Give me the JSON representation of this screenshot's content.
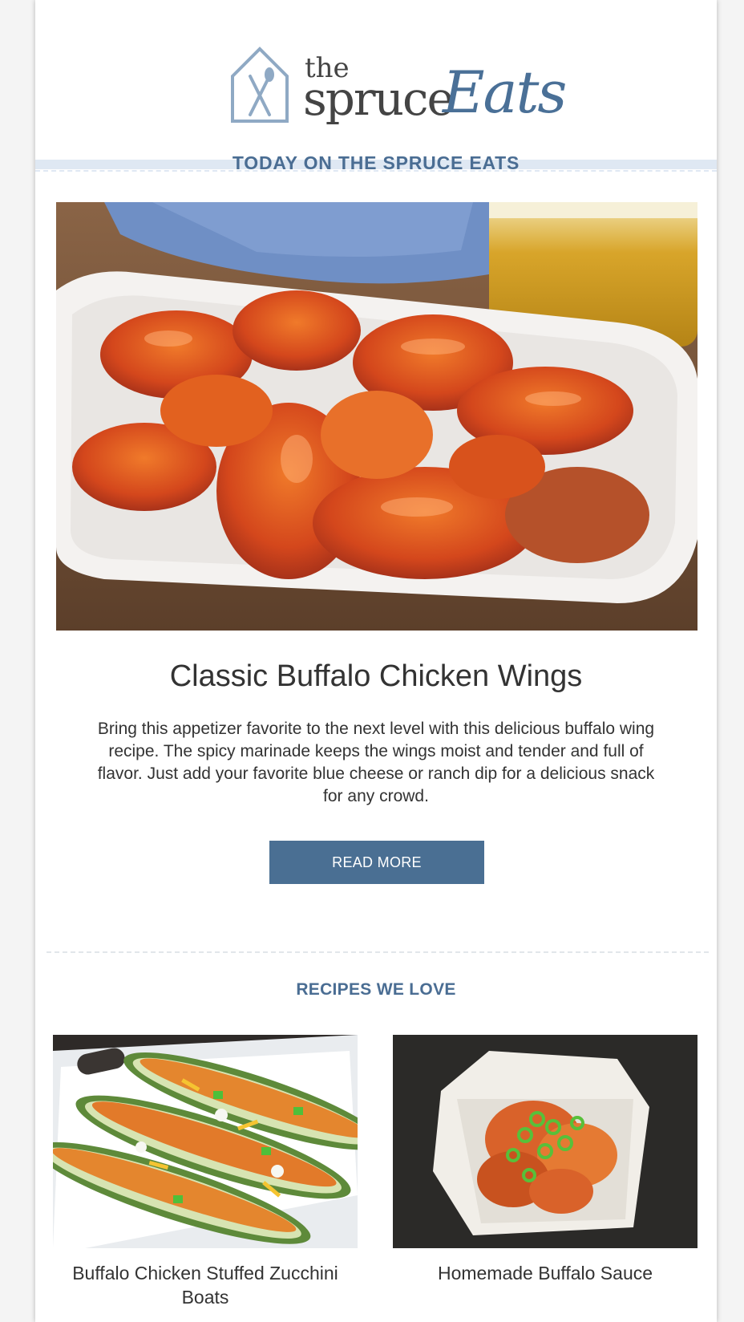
{
  "header": {
    "logo": {
      "the": "the",
      "spruce": "spruce",
      "eats": "Eats"
    },
    "banner": "TODAY ON THE SPRUCE EATS"
  },
  "feature": {
    "title": "Classic Buffalo Chicken Wings",
    "description": "Bring this appetizer favorite to the next level with this delicious buffalo wing recipe. The spicy marinade keeps the wings moist and tender and full of flavor. Just add your favorite blue cheese or ranch dip for a delicious snack for any crowd.",
    "button_label": "READ MORE"
  },
  "recipes": {
    "heading": "RECIPES WE LOVE",
    "items": [
      {
        "title": "Buffalo Chicken Stuffed Zucchini Boats"
      },
      {
        "title": "Homemade Buffalo Sauce"
      }
    ]
  },
  "colors": {
    "brand_blue": "#4a6f93",
    "banner_bg": "#dfe8f3",
    "text": "#333333"
  }
}
